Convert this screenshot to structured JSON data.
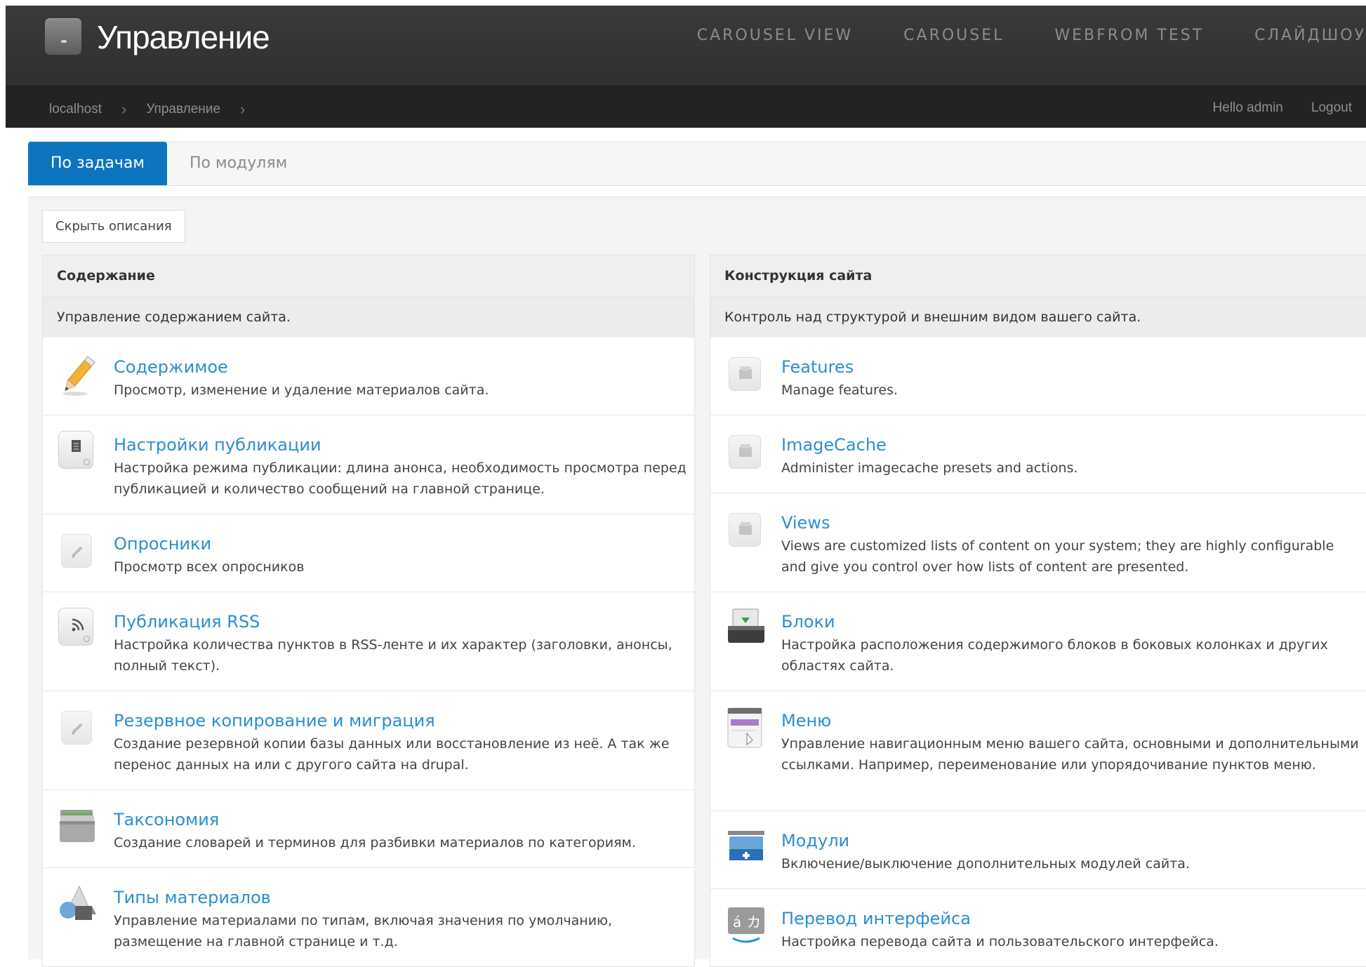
{
  "header": {
    "site_title": "Управление",
    "nav": [
      "CAROUSEL VIEW",
      "CAROUSEL",
      "WEBFROM TEST",
      "СЛАЙДШОУ"
    ],
    "breadcrumb": [
      "localhost",
      "Управление"
    ],
    "user_greeting": "Hello admin",
    "logout": "Logout",
    "breadcrumb_sep": "›"
  },
  "tabs": {
    "active": "По задачам",
    "inactive": "По модулям"
  },
  "hide_descriptions": "Скрыть описания",
  "left_panel": {
    "title": "Содержание",
    "description": "Управление содержанием сайта.",
    "items": [
      {
        "title": "Содержимое",
        "desc": "Просмотр, изменение и удаление материалов сайта.",
        "icon": "pencil-icon"
      },
      {
        "title": "Настройки публикации",
        "desc": "Настройка режима публикации: длина анонса, необходимость просмотра перед публикацией и количество сообщений на главной странице.",
        "icon": "document-icon"
      },
      {
        "title": "Опросники",
        "desc": "Просмотр всех опросников",
        "icon": "pencil-faded-icon"
      },
      {
        "title": "Публикация RSS",
        "desc": "Настройка количества пунктов в RSS-ленте и их характер (заголовки, анонсы, полный текст).",
        "icon": "rss-icon"
      },
      {
        "title": "Резервное копирование и миграция",
        "desc": "Создание резервной копии базы данных или восстановление из неё. А так же перенос данных на или с другого сайта на drupal.",
        "icon": "pencil-faded-icon"
      },
      {
        "title": "Таксономия",
        "desc": "Создание словарей и терминов для разбивки материалов по категориям.",
        "icon": "folders-icon"
      },
      {
        "title": "Типы материалов",
        "desc": "Управление материалами по типам, включая значения по умолчанию, размещение на главной странице и т.д.",
        "icon": "shapes-icon"
      }
    ]
  },
  "right_panel": {
    "title": "Конструкция сайта",
    "description": "Контроль над структурой и внешним видом вашего сайта.",
    "items": [
      {
        "title": "Features",
        "desc": "Manage features.",
        "icon": "module-box-icon"
      },
      {
        "title": "ImageCache",
        "desc": "Administer imagecache presets and actions.",
        "icon": "module-box-icon"
      },
      {
        "title": "Views",
        "desc": "Views are customized lists of content on your system; they are highly configurable and give you control over how lists of content are presented.",
        "icon": "module-box-icon"
      },
      {
        "title": "Блоки",
        "desc": "Настройка расположения содержимого блоков в боковых колонках и других областях сайта.",
        "icon": "blocks-icon"
      },
      {
        "title": "Меню",
        "desc": "Управление навигационным меню вашего сайта, основными и дополнительными ссылками. Например, переименование или упорядочивание пунктов меню.",
        "icon": "menu-icon"
      },
      {
        "title": "Модули",
        "desc": "Включение/выключение дополнительных модулей сайта.",
        "icon": "modules-icon"
      },
      {
        "title": "Перевод интерфейса",
        "desc": "Настройка перевода сайта и пользовательского интерфейса.",
        "icon": "translate-icon"
      }
    ]
  },
  "colors": {
    "accent": "#0d74c0",
    "link": "#2b8fd0",
    "header_bg": "#333333"
  }
}
